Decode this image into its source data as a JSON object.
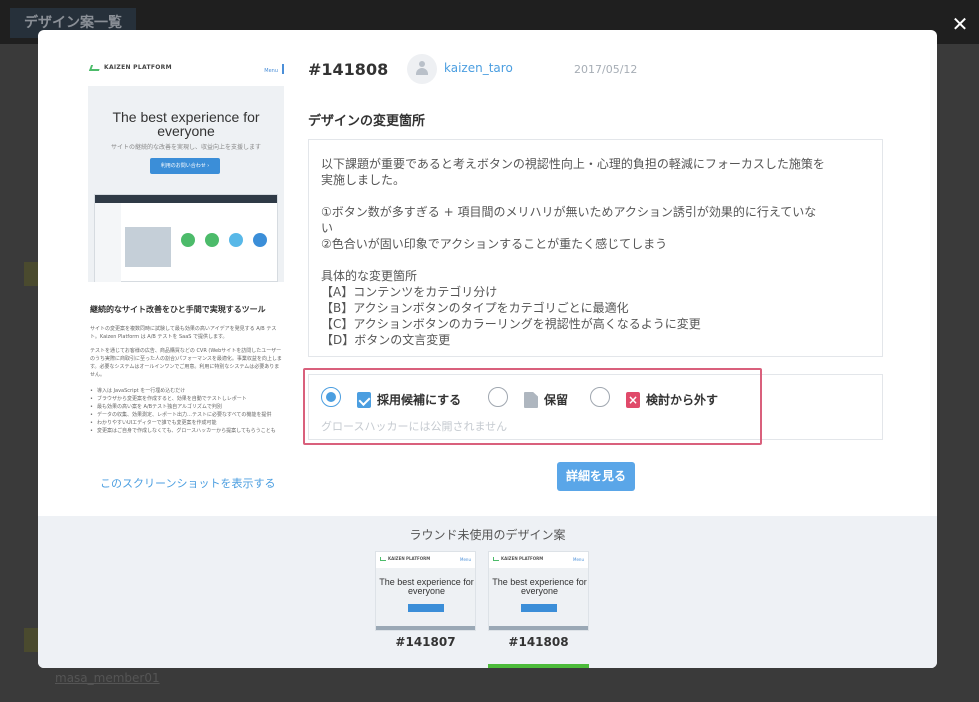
{
  "background_page": {
    "title": "デザイン案一覧",
    "footer_label": "masa_member01"
  },
  "modal": {
    "close_icon": "close-icon",
    "preview": {
      "logo_text": "KAIZEN PLATFORM",
      "menu_text": "Menu",
      "hero_title": "The best experience for everyone",
      "hero_subtitle": "サイトの継続的な改善を実現し、収益向上を支援します",
      "hero_button": "利用のお問い合わせ ›",
      "section_heading": "継続的なサイト改善をひと手間で実現するツール",
      "paragraph1": "サイトの変更案を複数同時に試験して最も効果の高いアイデアを発見する A/B テスト。Kaizen Platform は A/B テストを SaaS で提供します。",
      "paragraph2": "テストを通じてお客様の広告、商品購買などの CVR (Webサイトを訪問したユーザーのうち実際に商取引に至った人の割合)パフォーマンスを最適化。事業収益を向上します。必要なシステムはオールインワンでご用意。利用に特別なシステムは必要ありません。",
      "list": [
        "導入は JavaScript を一行埋め込むだけ",
        "ブラウザから変更案を作成すると、効果を自動でテストしレポート",
        "最も効果の高い案を A/Bテスト独自アルゴリズムで判別",
        "データの収集、効果測定、レポート出力…テストに必要なすべての機能を提供",
        "わかりやすいUIエディターで誰でも変更案を作成可能",
        "変更案はご自身で作成しなくても、グロースハッカーから提案してもらうことも"
      ],
      "show_screenshot_link": "このスクリーンショットを表示する"
    },
    "design_id": "#141808",
    "author": "kaizen_taro",
    "date": "2017/05/12",
    "section_title": "デザインの変更箇所",
    "change_lines": [
      "以下課題が重要であると考えボタンの視認性向上・心理的負担の軽減にフォーカスした施策を",
      "実施しました。",
      "",
      "①ボタン数が多すぎる + 項目間のメリハリが無いためアクション誘引が効果的に行えていな",
      "い",
      "②色合いが固い印象でアクションすることが重たく感じてしまう",
      "",
      "具体的な変更箇所",
      "【A】コンテンツをカテゴリ分け",
      "【B】アクションボタンのタイプをカテゴリごとに最適化",
      "【C】アクションボタンのカラーリングを視認性が高くなるように変更",
      "【D】ボタンの文言変更"
    ],
    "decision": {
      "selected": "adopt",
      "options": [
        {
          "id": "adopt",
          "label": "採用候補にする",
          "icon": "checkbox-icon"
        },
        {
          "id": "hold",
          "label": "保留",
          "icon": "document-icon"
        },
        {
          "id": "exclude",
          "label": "検討から外す",
          "icon": "cross-icon"
        }
      ],
      "note": "グロースハッカーには公開されません"
    },
    "detail_button": "詳細を見る",
    "unused_section": {
      "title": "ラウンド未使用のデザイン案",
      "thumbnails": [
        {
          "id": "#141807",
          "hero_title": "The best experience for everyone",
          "logo": "KAIZEN PLATFORM",
          "menu": "Menu",
          "active": false
        },
        {
          "id": "#141808",
          "hero_title": "The best experience for everyone",
          "logo": "KAIZEN PLATFORM",
          "menu": "Menu",
          "active": true
        }
      ]
    },
    "colors": {
      "accent": "#4b9ee0",
      "highlight_border": "#d9607c",
      "active_thumb": "#4cbb3a",
      "exclude_icon": "#e04a6a"
    }
  }
}
